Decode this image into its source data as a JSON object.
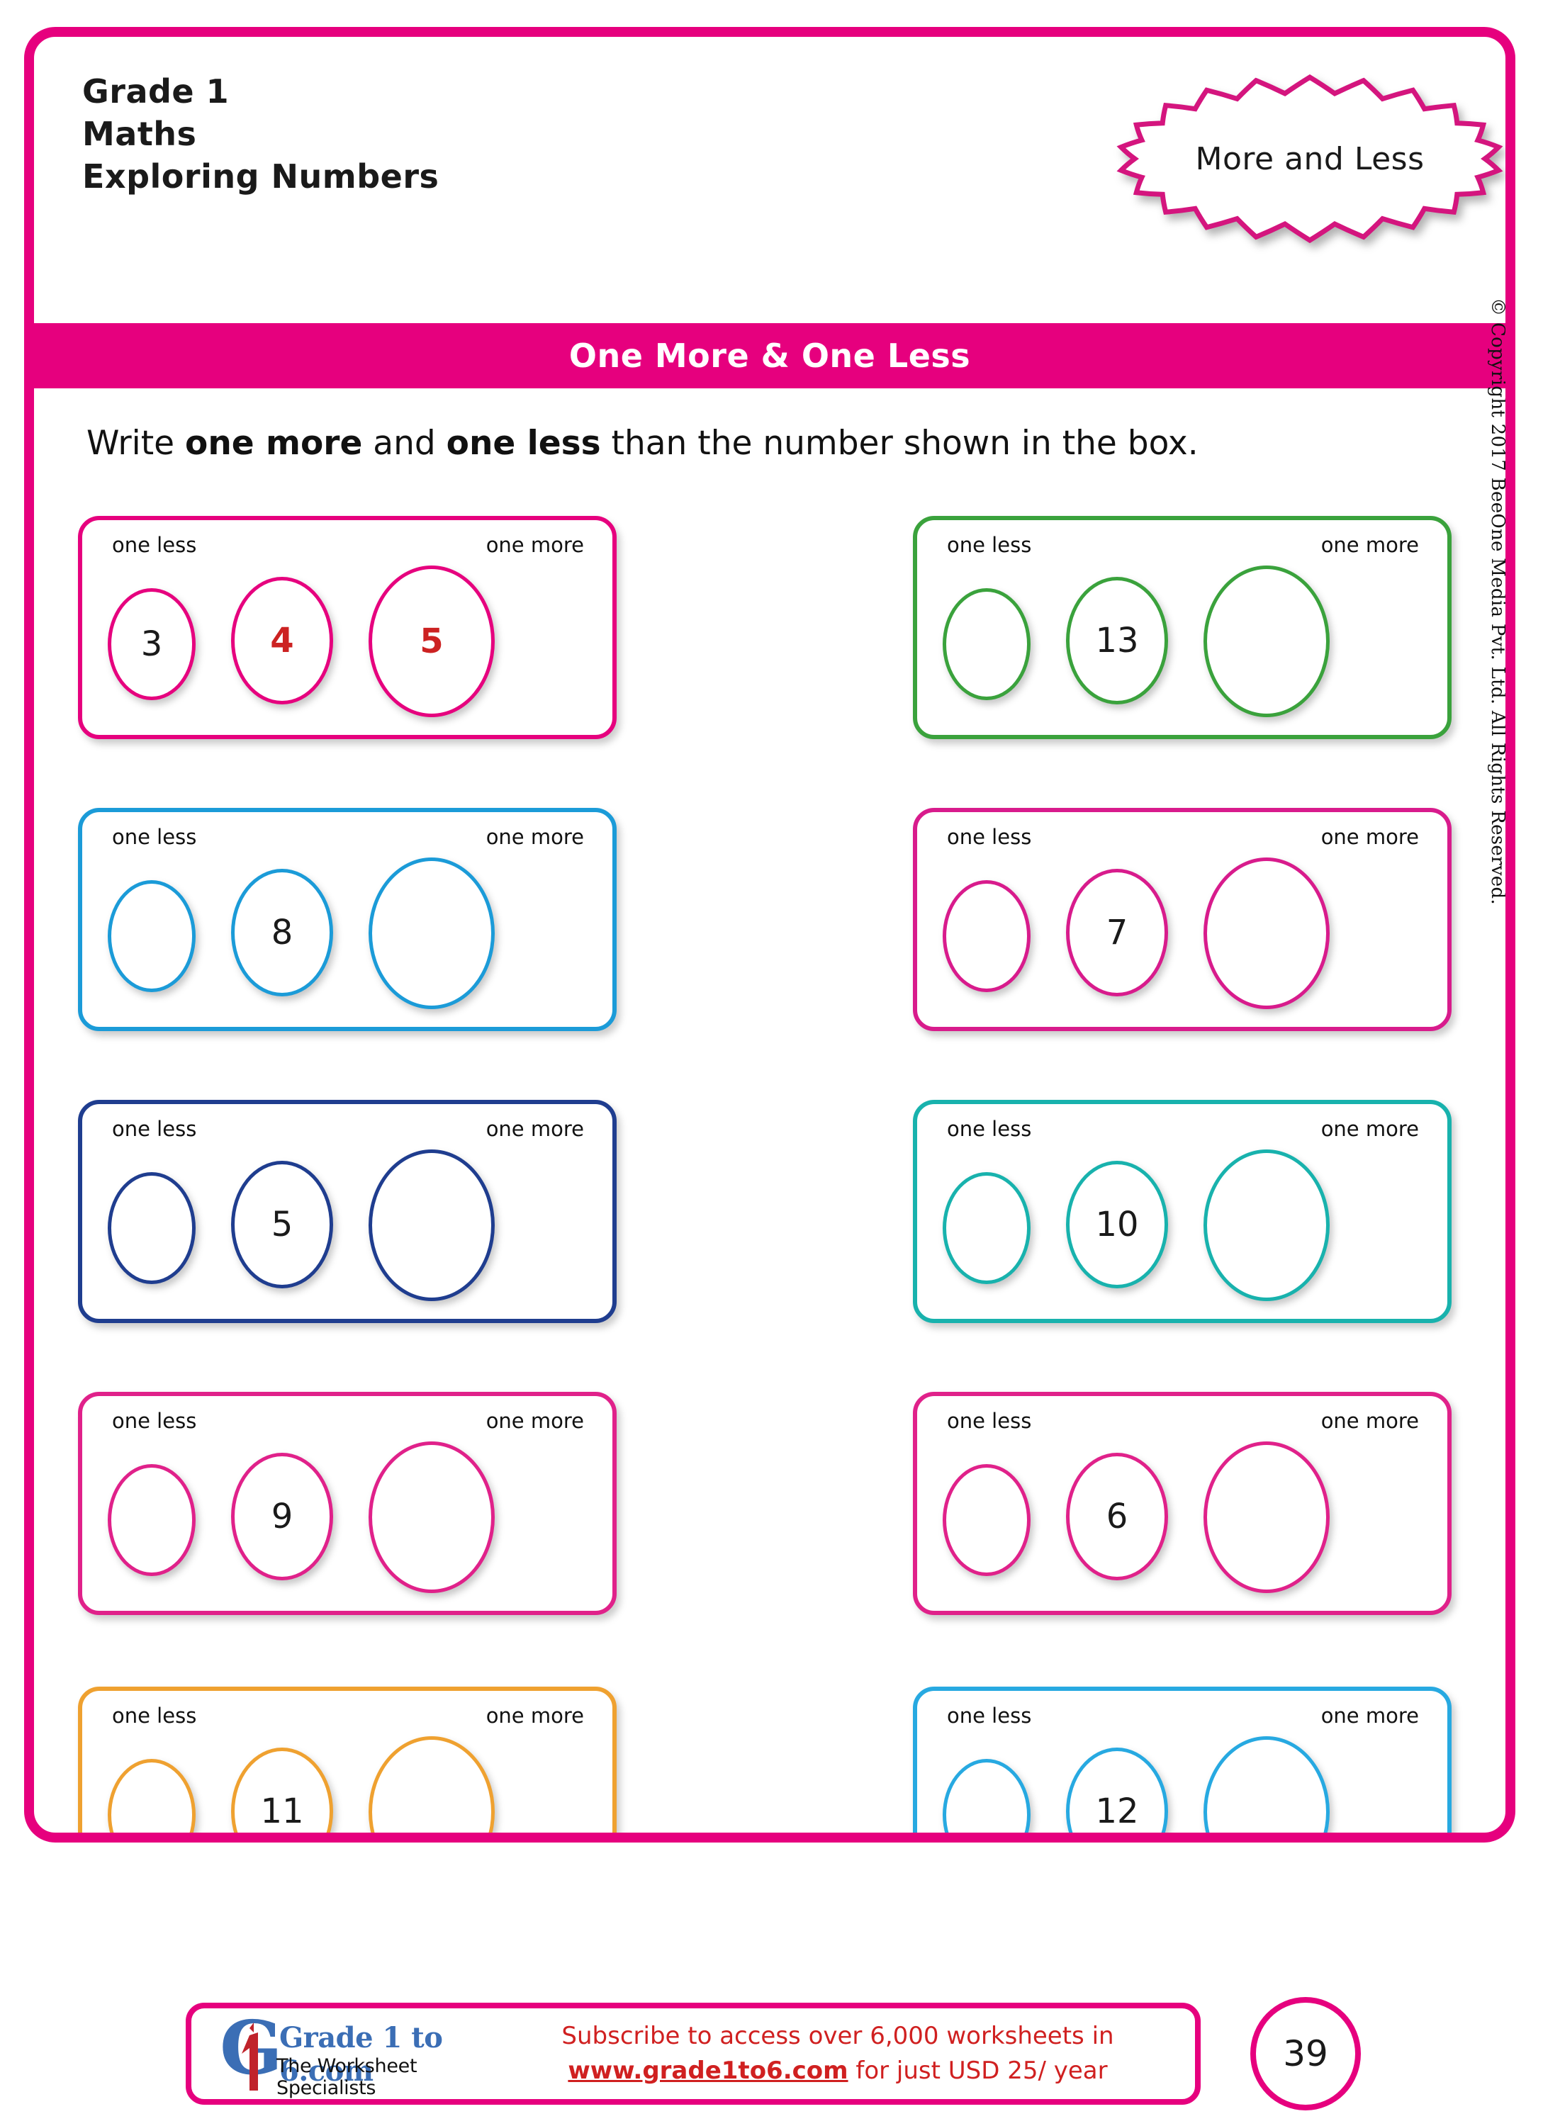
{
  "header": {
    "grade": "Grade 1",
    "subject": "Maths",
    "unit": "Exploring Numbers",
    "topic_badge": "More and Less"
  },
  "section": {
    "title": "One More & One Less",
    "bar_color": "#E6007E"
  },
  "instruction": {
    "prefix": "Write ",
    "bold_1": "one more",
    "middle": " and ",
    "bold_2": "one less",
    "suffix": " than the number shown in the box."
  },
  "labels": {
    "one_less": "one less",
    "one_more": "one more"
  },
  "problems": [
    {
      "id": 1,
      "color": "#E6007E",
      "column": "left",
      "row": 1,
      "one_less": "3",
      "number": "4",
      "one_more": "5",
      "is_example": true,
      "one_less_color": "#1a1a1a",
      "number_color": "#CC2222",
      "one_more_color": "#CC2222"
    },
    {
      "id": 2,
      "color": "#3AA23C",
      "column": "right",
      "row": 1,
      "one_less": "",
      "number": "13",
      "one_more": "",
      "is_example": false
    },
    {
      "id": 3,
      "color": "#1B9BD8",
      "column": "left",
      "row": 2,
      "one_less": "",
      "number": "8",
      "one_more": "",
      "is_example": false
    },
    {
      "id": 4,
      "color": "#D81B8C",
      "column": "right",
      "row": 2,
      "one_less": "",
      "number": "7",
      "one_more": "",
      "is_example": false
    },
    {
      "id": 5,
      "color": "#1F3D8F",
      "column": "left",
      "row": 3,
      "one_less": "",
      "number": "5",
      "one_more": "",
      "is_example": false
    },
    {
      "id": 6,
      "color": "#18B2AD",
      "column": "right",
      "row": 3,
      "one_less": "",
      "number": "10",
      "one_more": "",
      "is_example": false
    },
    {
      "id": 7,
      "color": "#E0218A",
      "column": "left",
      "row": 4,
      "one_less": "",
      "number": "9",
      "one_more": "",
      "is_example": false
    },
    {
      "id": 8,
      "color": "#E0218A",
      "column": "right",
      "row": 4,
      "one_less": "",
      "number": "6",
      "one_more": "",
      "is_example": false
    },
    {
      "id": 9,
      "color": "#EFA130",
      "column": "left",
      "row": 5,
      "one_less": "",
      "number": "11",
      "one_more": "",
      "is_example": false
    },
    {
      "id": 10,
      "color": "#27A9E1",
      "column": "right",
      "row": 5,
      "one_less": "",
      "number": "12",
      "one_more": "",
      "is_example": false
    }
  ],
  "copyright": "© Copyright 2017 BeeOne Media Pvt. Ltd. All Rights Reserved.",
  "footer": {
    "logo_name": "Grade 1 to 6.com",
    "logo_tagline": "The Worksheet Specialists",
    "logo_letter": "G",
    "logo_digit": "1",
    "promo_line1": "Subscribe to access over 6,000 worksheets in",
    "promo_url": "www.grade1to6.com",
    "promo_line2_rest": " for just USD 25/ year",
    "page_number": "39"
  }
}
